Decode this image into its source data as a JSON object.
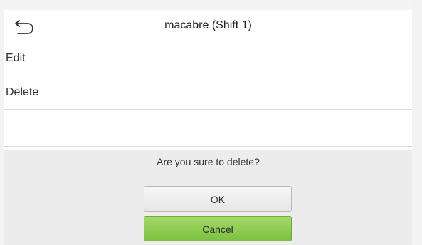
{
  "header": {
    "title": "macabre (Shift 1)",
    "back_icon": "back-arrow-icon"
  },
  "menu": {
    "items": [
      {
        "label": "Edit"
      },
      {
        "label": "Delete"
      },
      {
        "label": ""
      }
    ]
  },
  "dialog": {
    "message": "Are you sure to delete?",
    "ok_label": "OK",
    "cancel_label": "Cancel"
  },
  "colors": {
    "cancel_button": "#86c847",
    "ok_button": "#eeeeee",
    "dialog_background": "#ececec"
  }
}
